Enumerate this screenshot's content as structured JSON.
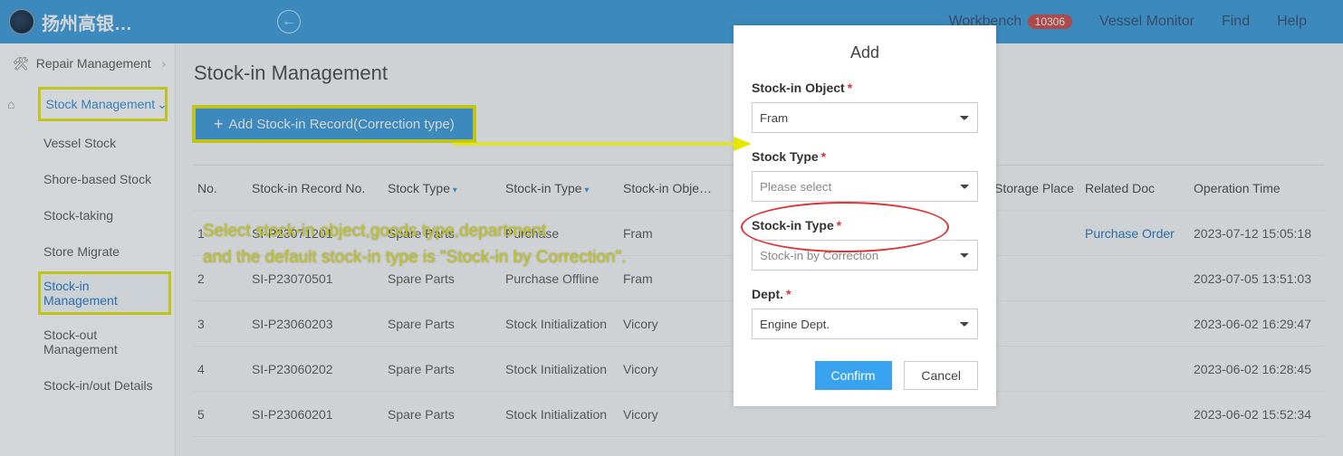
{
  "topbar": {
    "app_name": "扬州高银…",
    "nav": {
      "workbench": "Workbench",
      "workbench_badge": "10306",
      "vessel_monitor": "Vessel Monitor",
      "find": "Find",
      "help": "Help"
    }
  },
  "sidebar": {
    "repair_head": "Repair Management",
    "section": "Stock Management",
    "items": {
      "vessel_stock": "Vessel Stock",
      "shore_stock": "Shore-based Stock",
      "stock_taking": "Stock-taking",
      "store_migrate": "Store Migrate",
      "stock_in_mgmt": "Stock-in Management",
      "stock_out_mgmt": "Stock-out Management",
      "stock_inout_details": "Stock-in/out Details"
    }
  },
  "main": {
    "page_title": "Stock-in Management",
    "add_button": "Add Stock-in Record(Correction type)"
  },
  "annotation": {
    "line1": "Select stock-in object,goods type,department",
    "line2": "and the default stock-in type is \"Stock-in by Correction\"."
  },
  "table": {
    "headers": {
      "no": "No.",
      "record_no": "Stock-in Record No.",
      "stock_type": "Stock Type",
      "stock_in_type": "Stock-in Type",
      "stock_in_object": "Stock-in Obje…",
      "storage_place": "Storage Place",
      "related_doc": "Related Doc",
      "op_time": "Operation Time"
    },
    "rows": [
      {
        "no": "1",
        "record": "SI-P23071201",
        "stype": "Spare Parts",
        "intype": "Purchase",
        "obj": "Fram",
        "place": "",
        "doc": "Purchase Order",
        "time": "2023-07-12 15:05:18"
      },
      {
        "no": "2",
        "record": "SI-P23070501",
        "stype": "Spare Parts",
        "intype": "Purchase Offline",
        "obj": "Fram",
        "place": "",
        "doc": "",
        "time": "2023-07-05 13:51:03"
      },
      {
        "no": "3",
        "record": "SI-P23060203",
        "stype": "Spare Parts",
        "intype": "Stock Initialization",
        "obj": "Vicory",
        "place": "",
        "doc": "",
        "time": "2023-06-02 16:29:47"
      },
      {
        "no": "4",
        "record": "SI-P23060202",
        "stype": "Spare Parts",
        "intype": "Stock Initialization",
        "obj": "Vicory",
        "place": "",
        "doc": "",
        "time": "2023-06-02 16:28:45"
      },
      {
        "no": "5",
        "record": "SI-P23060201",
        "stype": "Spare Parts",
        "intype": "Stock Initialization",
        "obj": "Vicory",
        "place": "",
        "doc": "",
        "time": "2023-06-02 15:52:34"
      }
    ]
  },
  "modal": {
    "title": "Add",
    "labels": {
      "object": "Stock-in Object",
      "stock_type": "Stock Type",
      "in_type": "Stock-in Type",
      "dept": "Dept."
    },
    "values": {
      "object": "Fram",
      "stock_type": "Please select",
      "in_type": "Stock-in by Correction",
      "dept": "Engine Dept."
    },
    "buttons": {
      "confirm": "Confirm",
      "cancel": "Cancel"
    }
  }
}
